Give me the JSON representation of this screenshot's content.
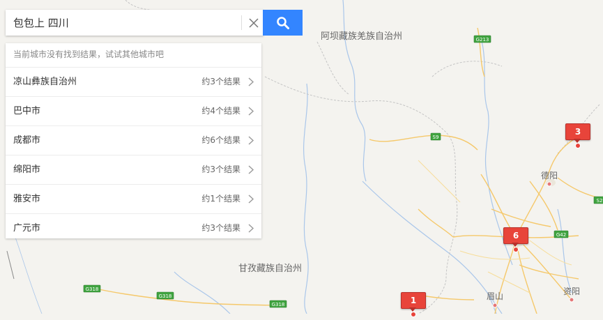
{
  "search": {
    "query": "包包上 四川",
    "clear_icon": "close-icon",
    "search_icon": "search-icon"
  },
  "results": {
    "hint": "当前城市没有找到结果，试试其他城市吧",
    "items": [
      {
        "city": "凉山彝族自治州",
        "count": "约3个结果"
      },
      {
        "city": "巴中市",
        "count": "约4个结果"
      },
      {
        "city": "成都市",
        "count": "约6个结果"
      },
      {
        "city": "绵阳市",
        "count": "约3个结果"
      },
      {
        "city": "雅安市",
        "count": "约1个结果"
      },
      {
        "city": "广元市",
        "count": "约3个结果"
      }
    ]
  },
  "map": {
    "labels": {
      "aba": "阿坝藏族羌族自治州",
      "ganzi": "甘孜藏族自治州",
      "deyang": "德阳",
      "meishan": "眉山",
      "ziyang": "资阳"
    },
    "roads": {
      "g213": "G213",
      "s9": "S9",
      "g42": "G42",
      "s2": "S2",
      "g318": "G318"
    },
    "markers": {
      "m3": "3",
      "m6": "6",
      "m1": "1"
    },
    "colors": {
      "marker": "#e8443a",
      "search_button": "#3385ff",
      "road_badge": "#3fa33f"
    }
  }
}
